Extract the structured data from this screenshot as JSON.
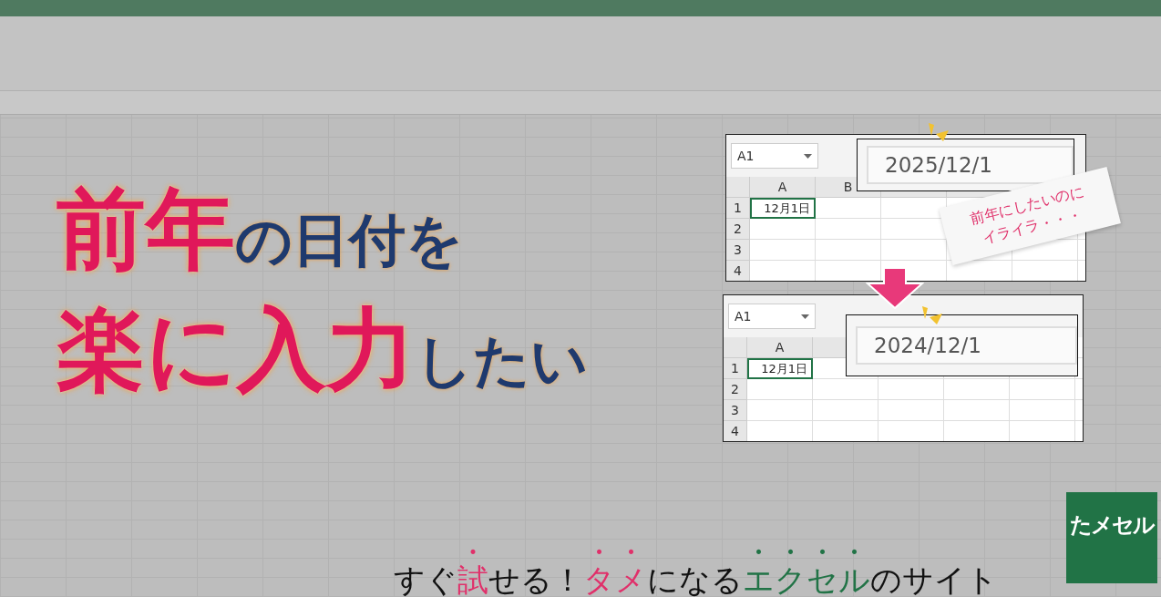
{
  "headline": {
    "lines": [
      [
        {
          "text": "前年",
          "kind": "accent"
        },
        {
          "text": "の日付を",
          "kind": "sub"
        }
      ],
      [
        {
          "text": "楽に入力",
          "kind": "accent"
        },
        {
          "text": "したい",
          "kind": "sub"
        }
      ]
    ]
  },
  "examples": [
    {
      "name_box": "A1",
      "columns": [
        "A",
        "B"
      ],
      "rows": [
        "1",
        "2",
        "3",
        "4"
      ],
      "cell_a1": "12月1日",
      "callout": "2025/12/1"
    },
    {
      "name_box": "A1",
      "columns": [
        "A"
      ],
      "rows": [
        "1",
        "2",
        "3",
        "4"
      ],
      "cell_a1": "12月1日",
      "callout": "2024/12/1"
    }
  ],
  "note": [
    "前年にしたいのに",
    "イライラ・・・"
  ],
  "tagline": [
    {
      "text": "すぐ",
      "kind": "plain"
    },
    {
      "text": "試",
      "kind": "pink"
    },
    {
      "text": "せる！",
      "kind": "plain"
    },
    {
      "text": "タメ",
      "kind": "pink"
    },
    {
      "text": "になる",
      "kind": "plain"
    },
    {
      "text": "エクセル",
      "kind": "green"
    },
    {
      "text": "のサイト",
      "kind": "plain"
    }
  ],
  "logo": "たメセル"
}
